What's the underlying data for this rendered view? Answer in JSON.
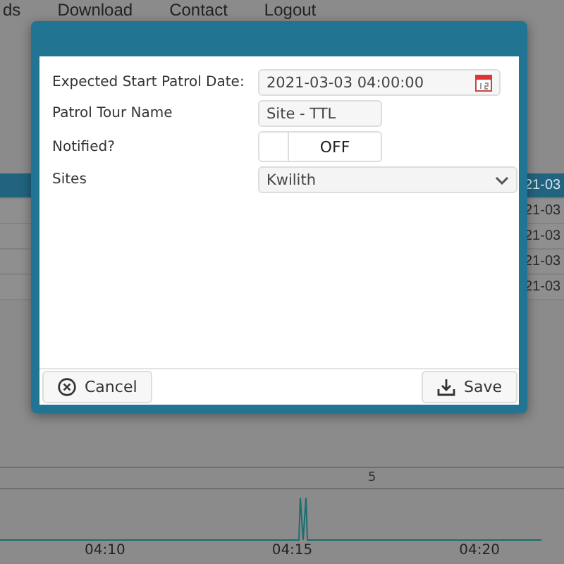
{
  "nav": [
    {
      "label": "ds"
    },
    {
      "label": "Download"
    },
    {
      "label": "Contact"
    },
    {
      "label": "Logout"
    }
  ],
  "table": {
    "rows": [
      {
        "cell": "21-03",
        "selected": true
      },
      {
        "cell": "21-03",
        "selected": false
      },
      {
        "cell": "21-03",
        "selected": false
      },
      {
        "cell": "21-03",
        "selected": false
      },
      {
        "cell": "21-03",
        "selected": false
      }
    ]
  },
  "timeline": {
    "label": "5",
    "ticks": [
      "04:10",
      "04:15",
      "04:20"
    ]
  },
  "dialog": {
    "fields": [
      {
        "kind": "date",
        "label": "Expected Start Patrol Date:",
        "value": "2021-03-03 04:00:00"
      },
      {
        "kind": "text",
        "label": "Patrol Tour Name",
        "value": "Site - TTL"
      },
      {
        "kind": "toggle",
        "label": "Notified?",
        "on": false,
        "text": "OFF"
      },
      {
        "kind": "select",
        "label": "Sites",
        "value": "Kwilith"
      }
    ],
    "buttons": [
      {
        "kind": "cancel",
        "label": "Cancel"
      },
      {
        "kind": "save",
        "label": "Save"
      }
    ]
  }
}
